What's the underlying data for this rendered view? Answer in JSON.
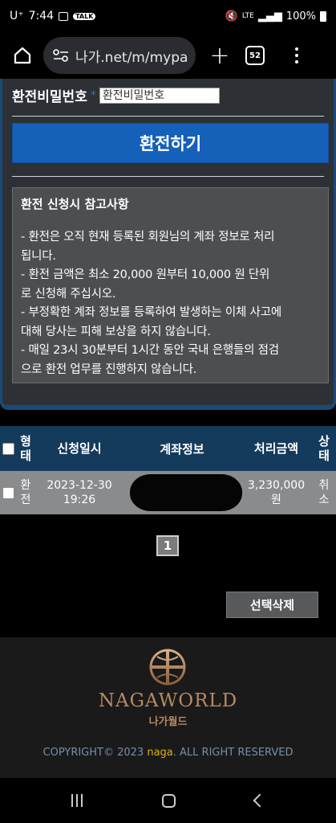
{
  "status_bar": {
    "carrier": "U⁺",
    "time": "7:44",
    "chat_badge": "TALK",
    "network": "LTE",
    "battery": "100%"
  },
  "browser": {
    "url": "나가.net/m/mypa",
    "tab_count": "52"
  },
  "form": {
    "password_label": "환전비밀번호",
    "password_placeholder": "환전비밀번호",
    "exchange_button": "환전하기"
  },
  "notice": {
    "title": "환전 신청시 참고사항",
    "lines": [
      "- 환전은 오직 현재 등록된 회원님의 계좌 정보로 처리",
      "됩니다.",
      "- 환전 금액은 최소 20,000 원부터 10,000 원 단위",
      "로 신청해 주십시오.",
      "- 부정확한 계좌 정보를 등록하여 발생하는 이체 사고에",
      "대해 당사는 피해 보상을 하지 않습니다.",
      "- 매일 23시 30분부터 1시간 동안 국내 은행들의 점검",
      "으로 환전 업무를 진행하지 않습니다."
    ]
  },
  "table": {
    "headers": {
      "type_1": "형",
      "type_2": "태",
      "date": "신청일시",
      "account": "계좌정보",
      "amount": "처리금액",
      "status_1": "상",
      "status_2": "태"
    },
    "rows": [
      {
        "type_1": "환",
        "type_2": "전",
        "date_1": "2023-12-30",
        "date_2": "19:26",
        "account": "",
        "amount_1": "3,230,000",
        "amount_2": "원",
        "status_1": "취",
        "status_2": "소"
      }
    ]
  },
  "pagination": {
    "current": "1"
  },
  "delete_button": "선택삭제",
  "footer": {
    "logo_text": "NAGAWORLD",
    "logo_sub": "나가월드",
    "copyright_pre": "COPYRIGHT© 2023 ",
    "copyright_brand": "naga",
    "copyright_post": ". ALL RIGHT RESERVED"
  }
}
